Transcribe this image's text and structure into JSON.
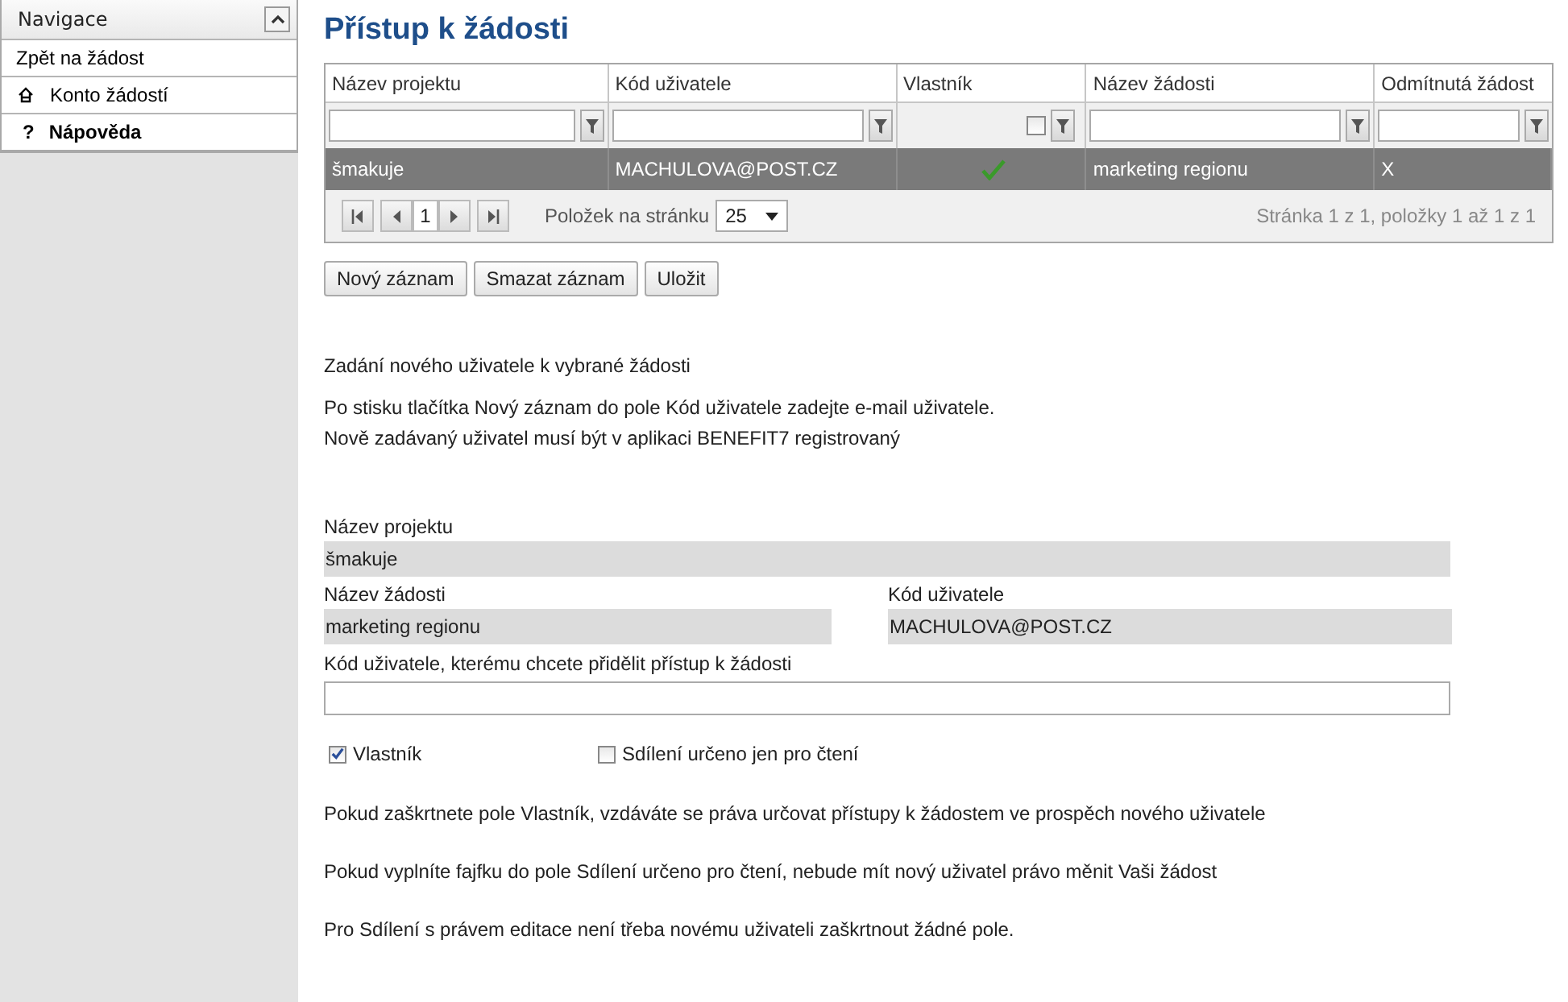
{
  "sidebar": {
    "title": "Navigace",
    "expanded": true,
    "items": [
      {
        "kind": "plain",
        "label": "Zpět na žádost"
      },
      {
        "kind": "home",
        "label": "Konto žádostí"
      },
      {
        "kind": "glyph",
        "glyph": "?",
        "label": "Nápověda"
      }
    ]
  },
  "page_title": "Přístup k žádosti",
  "table": {
    "columns": [
      {
        "label": "Název projektu",
        "kind": "text"
      },
      {
        "label": "Kód uživatele",
        "kind": "text"
      },
      {
        "label": "Vlastník",
        "kind": "checkbox",
        "checked": false
      },
      {
        "label": "Název žádosti",
        "kind": "text"
      },
      {
        "label": "Odmítnutá žádost",
        "kind": "text"
      }
    ],
    "rows": [
      {
        "selected": true,
        "cells": [
          {
            "kind": "text",
            "text": "šmakuje"
          },
          {
            "kind": "text",
            "text": "MACHULOVA@POST.CZ"
          },
          {
            "kind": "check",
            "checked": true
          },
          {
            "kind": "text",
            "text": "marketing regionu"
          },
          {
            "kind": "text",
            "text": "X"
          }
        ]
      }
    ],
    "pager": {
      "page": "1",
      "per_page_label": "Položek na stránku",
      "per_page": "25",
      "summary": "Stránka 1 z 1, položky 1 až 1 z 1"
    }
  },
  "buttons": [
    "Nový záznam",
    "Smazat záznam",
    "Uložit"
  ],
  "intro": [
    "Zadání nového uživatele k vybrané žádosti",
    "Po stisku tlačítka Nový záznam do pole Kód uživatele zadejte e-mail uživatele.",
    "Nově zadávaný uživatel musí být v aplikaci BENEFIT7 registrovaný"
  ],
  "form": {
    "project": {
      "label": "Název projektu",
      "value": "šmakuje"
    },
    "request": {
      "label": "Název žádosti",
      "value": "marketing regionu"
    },
    "user": {
      "label": "Kód uživatele",
      "value": "MACHULOVA@POST.CZ"
    },
    "new_user": {
      "label": "Kód uživatele, kterému chcete přidělit přístup k žádosti"
    },
    "checkboxes": [
      {
        "label": "Vlastník",
        "checked": true
      },
      {
        "label": "Sdílení určeno jen pro čtení",
        "checked": false
      }
    ]
  },
  "notes": [
    "Pokud zaškrtnete pole Vlastník, vzdáváte se práva určovat přístupy k žádostem ve prospěch nového uživatele",
    "Pokud vyplníte fajfku do pole Sdílení určeno pro čtení, nebude mít nový uživatel právo měnit Vaši žádost",
    "Pro Sdílení s právem editace není třeba novému uživateli zaškrtnout žádné pole."
  ]
}
